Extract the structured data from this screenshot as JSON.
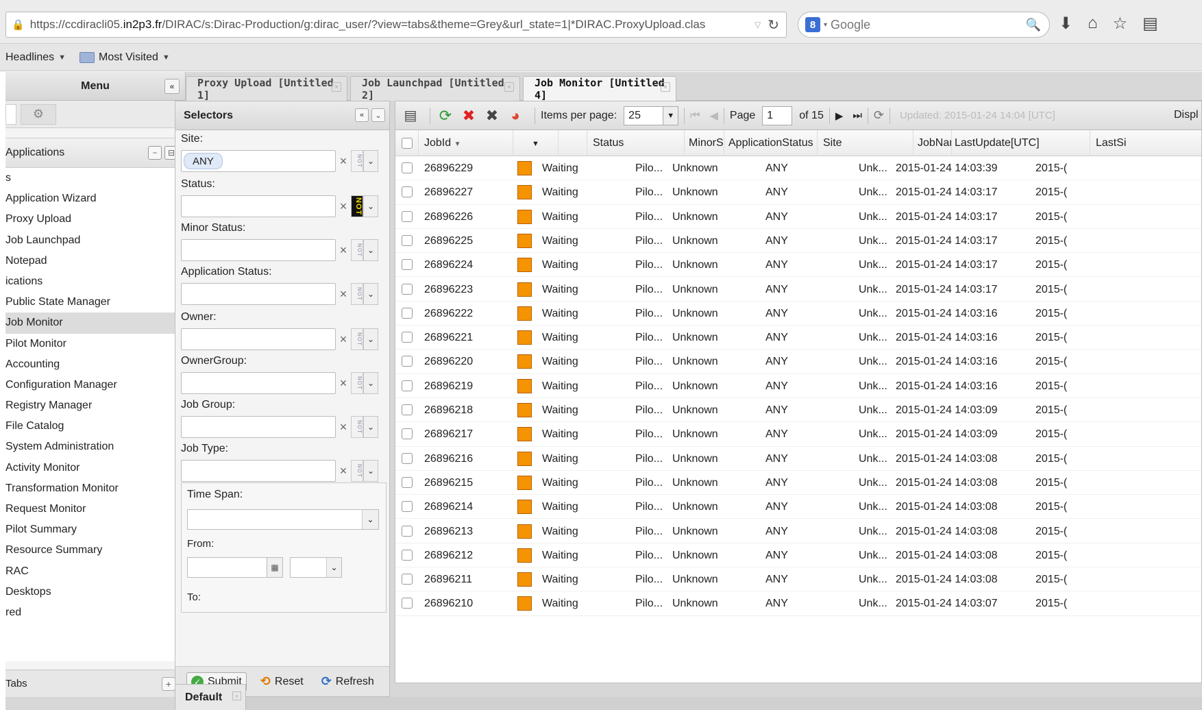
{
  "browser": {
    "url_prefix": "https://ccdiracli05.",
    "url_host": "in2p3.fr",
    "url_rest": "/DIRAC/s:Dirac-Production/g:dirac_user/?view=tabs&theme=Grey&url_state=1|*DIRAC.ProxyUpload.clas",
    "search_placeholder": "Google",
    "bookmarks": [
      {
        "label": "Headlines"
      },
      {
        "label": "Most Visited"
      }
    ]
  },
  "menu": {
    "title": "Menu",
    "applications_header": "Applications",
    "items": [
      {
        "label": "s",
        "active": false
      },
      {
        "label": "Application Wizard",
        "active": false
      },
      {
        "label": "Proxy Upload",
        "active": false
      },
      {
        "label": "Job Launchpad",
        "active": false
      },
      {
        "label": "Notepad",
        "active": false
      },
      {
        "label": "ications",
        "active": false
      },
      {
        "label": "Public State Manager",
        "active": false
      },
      {
        "label": "Job Monitor",
        "active": true
      },
      {
        "label": "Pilot Monitor",
        "active": false
      },
      {
        "label": "Accounting",
        "active": false
      },
      {
        "label": "Configuration Manager",
        "active": false
      },
      {
        "label": "Registry Manager",
        "active": false
      },
      {
        "label": "File Catalog",
        "active": false
      },
      {
        "label": "System Administration",
        "active": false
      },
      {
        "label": "Activity Monitor",
        "active": false
      },
      {
        "label": "Transformation Monitor",
        "active": false
      },
      {
        "label": "Request Monitor",
        "active": false
      },
      {
        "label": "Pilot Summary",
        "active": false
      },
      {
        "label": "Resource Summary",
        "active": false
      },
      {
        "label": "RAC",
        "active": false
      },
      {
        "label": "Desktops",
        "active": false
      },
      {
        "label": "red",
        "active": false
      }
    ],
    "footer_label": "Tabs"
  },
  "tabs": [
    {
      "label": "Proxy Upload [Untitled 1]",
      "active": false
    },
    {
      "label": "Job Launchpad [Untitled 2]",
      "active": false
    },
    {
      "label": "Job Monitor [Untitled 4]",
      "active": true
    }
  ],
  "selectors": {
    "title": "Selectors",
    "fields": [
      {
        "label": "Site:",
        "chip": "ANY",
        "not_active": false
      },
      {
        "label": "Status:",
        "chip": "",
        "not_active": true
      },
      {
        "label": "Minor Status:",
        "chip": "",
        "not_active": false
      },
      {
        "label": "Application Status:",
        "chip": "",
        "not_active": false
      },
      {
        "label": "Owner:",
        "chip": "",
        "not_active": false
      },
      {
        "label": "OwnerGroup:",
        "chip": "",
        "not_active": false
      },
      {
        "label": "Job Group:",
        "chip": "",
        "not_active": false
      },
      {
        "label": "Job Type:",
        "chip": "",
        "not_active": false
      }
    ],
    "not_label": "NOT",
    "time_span_label": "Time Span:",
    "from_label": "From:",
    "to_label": "To:",
    "submit_label": "Submit",
    "reset_label": "Reset",
    "refresh_label": "Refresh"
  },
  "toolbar": {
    "items_per_page_label": "Items per page:",
    "items_per_page": "25",
    "page_label": "Page",
    "page": "1",
    "of_pages": "of 15",
    "updated": "Updated: 2015-01-24 14:04 [UTC]",
    "display_label": "Displ"
  },
  "table": {
    "columns": [
      "JobId",
      "Status",
      "MinorS",
      "ApplicationStatus",
      "Site",
      "JobNar",
      "LastUpdate[UTC]",
      "LastSi"
    ],
    "status_color": "#f59300",
    "rows": [
      {
        "jobid": "26896229",
        "status": "Waiting",
        "minor": "Pilo...",
        "app": "Unknown",
        "site": "ANY",
        "jobname": "Unk...",
        "lastupdate": "2015-01-24 14:03:39",
        "lastsig": "2015-("
      },
      {
        "jobid": "26896227",
        "status": "Waiting",
        "minor": "Pilo...",
        "app": "Unknown",
        "site": "ANY",
        "jobname": "Unk...",
        "lastupdate": "2015-01-24 14:03:17",
        "lastsig": "2015-("
      },
      {
        "jobid": "26896226",
        "status": "Waiting",
        "minor": "Pilo...",
        "app": "Unknown",
        "site": "ANY",
        "jobname": "Unk...",
        "lastupdate": "2015-01-24 14:03:17",
        "lastsig": "2015-("
      },
      {
        "jobid": "26896225",
        "status": "Waiting",
        "minor": "Pilo...",
        "app": "Unknown",
        "site": "ANY",
        "jobname": "Unk...",
        "lastupdate": "2015-01-24 14:03:17",
        "lastsig": "2015-("
      },
      {
        "jobid": "26896224",
        "status": "Waiting",
        "minor": "Pilo...",
        "app": "Unknown",
        "site": "ANY",
        "jobname": "Unk...",
        "lastupdate": "2015-01-24 14:03:17",
        "lastsig": "2015-("
      },
      {
        "jobid": "26896223",
        "status": "Waiting",
        "minor": "Pilo...",
        "app": "Unknown",
        "site": "ANY",
        "jobname": "Unk...",
        "lastupdate": "2015-01-24 14:03:17",
        "lastsig": "2015-("
      },
      {
        "jobid": "26896222",
        "status": "Waiting",
        "minor": "Pilo...",
        "app": "Unknown",
        "site": "ANY",
        "jobname": "Unk...",
        "lastupdate": "2015-01-24 14:03:16",
        "lastsig": "2015-("
      },
      {
        "jobid": "26896221",
        "status": "Waiting",
        "minor": "Pilo...",
        "app": "Unknown",
        "site": "ANY",
        "jobname": "Unk...",
        "lastupdate": "2015-01-24 14:03:16",
        "lastsig": "2015-("
      },
      {
        "jobid": "26896220",
        "status": "Waiting",
        "minor": "Pilo...",
        "app": "Unknown",
        "site": "ANY",
        "jobname": "Unk...",
        "lastupdate": "2015-01-24 14:03:16",
        "lastsig": "2015-("
      },
      {
        "jobid": "26896219",
        "status": "Waiting",
        "minor": "Pilo...",
        "app": "Unknown",
        "site": "ANY",
        "jobname": "Unk...",
        "lastupdate": "2015-01-24 14:03:16",
        "lastsig": "2015-("
      },
      {
        "jobid": "26896218",
        "status": "Waiting",
        "minor": "Pilo...",
        "app": "Unknown",
        "site": "ANY",
        "jobname": "Unk...",
        "lastupdate": "2015-01-24 14:03:09",
        "lastsig": "2015-("
      },
      {
        "jobid": "26896217",
        "status": "Waiting",
        "minor": "Pilo...",
        "app": "Unknown",
        "site": "ANY",
        "jobname": "Unk...",
        "lastupdate": "2015-01-24 14:03:09",
        "lastsig": "2015-("
      },
      {
        "jobid": "26896216",
        "status": "Waiting",
        "minor": "Pilo...",
        "app": "Unknown",
        "site": "ANY",
        "jobname": "Unk...",
        "lastupdate": "2015-01-24 14:03:08",
        "lastsig": "2015-("
      },
      {
        "jobid": "26896215",
        "status": "Waiting",
        "minor": "Pilo...",
        "app": "Unknown",
        "site": "ANY",
        "jobname": "Unk...",
        "lastupdate": "2015-01-24 14:03:08",
        "lastsig": "2015-("
      },
      {
        "jobid": "26896214",
        "status": "Waiting",
        "minor": "Pilo...",
        "app": "Unknown",
        "site": "ANY",
        "jobname": "Unk...",
        "lastupdate": "2015-01-24 14:03:08",
        "lastsig": "2015-("
      },
      {
        "jobid": "26896213",
        "status": "Waiting",
        "minor": "Pilo...",
        "app": "Unknown",
        "site": "ANY",
        "jobname": "Unk...",
        "lastupdate": "2015-01-24 14:03:08",
        "lastsig": "2015-("
      },
      {
        "jobid": "26896212",
        "status": "Waiting",
        "minor": "Pilo...",
        "app": "Unknown",
        "site": "ANY",
        "jobname": "Unk...",
        "lastupdate": "2015-01-24 14:03:08",
        "lastsig": "2015-("
      },
      {
        "jobid": "26896211",
        "status": "Waiting",
        "minor": "Pilo...",
        "app": "Unknown",
        "site": "ANY",
        "jobname": "Unk...",
        "lastupdate": "2015-01-24 14:03:08",
        "lastsig": "2015-("
      },
      {
        "jobid": "26896210",
        "status": "Waiting",
        "minor": "Pilo...",
        "app": "Unknown",
        "site": "ANY",
        "jobname": "Unk...",
        "lastupdate": "2015-01-24 14:03:07",
        "lastsig": "2015-("
      }
    ]
  },
  "bottom_tab": {
    "label": "Default"
  }
}
